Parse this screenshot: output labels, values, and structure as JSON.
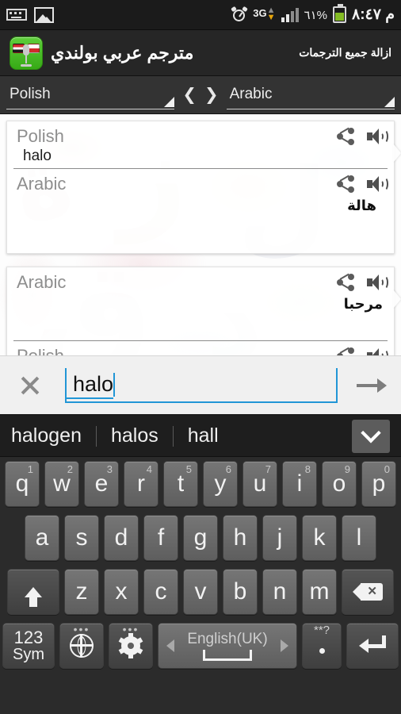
{
  "statusbar": {
    "icons": [
      "keyboard-icon",
      "image-icon",
      "alarm-icon",
      "signal-icon",
      "battery-icon"
    ],
    "network_label": "3G",
    "battery_percent": "٦١%",
    "clock": "م ٨:٤٧"
  },
  "actionbar": {
    "app_icon": "app-logo-icon",
    "title": "مترجم عربي بولندي",
    "clear_all_label": "ازالة جميع الترجمات"
  },
  "langrow": {
    "source": "Polish",
    "target": "Arabic",
    "swap_prev": "❮",
    "swap_next": "❯"
  },
  "cards": [
    {
      "source_label": "Polish",
      "source_text": "halo",
      "target_label": "Arabic",
      "target_text": "هالة"
    },
    {
      "source_label": "Arabic",
      "source_text": "مرحبا",
      "target_label": "Polish",
      "target_text": ""
    }
  ],
  "input": {
    "clear_icon": "close-icon",
    "value": "halo",
    "placeholder": "",
    "submit_icon": "arrow-right-icon"
  },
  "keyboard": {
    "suggestions": [
      "halogen",
      "halos",
      "hall"
    ],
    "expand_icon": "chevron-down-icon",
    "row1": [
      {
        "ch": "q",
        "num": "1"
      },
      {
        "ch": "w",
        "num": "2"
      },
      {
        "ch": "e",
        "num": "3"
      },
      {
        "ch": "r",
        "num": "4"
      },
      {
        "ch": "t",
        "num": "5"
      },
      {
        "ch": "y",
        "num": "6"
      },
      {
        "ch": "u",
        "num": "7"
      },
      {
        "ch": "i",
        "num": "8"
      },
      {
        "ch": "o",
        "num": "9"
      },
      {
        "ch": "p",
        "num": "0"
      }
    ],
    "row2": [
      {
        "ch": "a"
      },
      {
        "ch": "s"
      },
      {
        "ch": "d"
      },
      {
        "ch": "f"
      },
      {
        "ch": "g"
      },
      {
        "ch": "h"
      },
      {
        "ch": "j"
      },
      {
        "ch": "k"
      },
      {
        "ch": "l"
      }
    ],
    "row3": [
      {
        "ch": "z"
      },
      {
        "ch": "x"
      },
      {
        "ch": "c"
      },
      {
        "ch": "v"
      },
      {
        "ch": "b"
      },
      {
        "ch": "n"
      },
      {
        "ch": "m"
      }
    ],
    "shift_icon": "shift-up-arrow-icon",
    "backspace_icon": "backspace-icon",
    "sym_line1": "123",
    "sym_line2": "Sym",
    "globe_icon": "globe-icon",
    "settings_icon": "gear-icon",
    "space_label": "English(UK)",
    "period_top": "**?",
    "period_label": ".",
    "enter_icon": "enter-icon"
  },
  "colors": {
    "accent_blue": "#2196d6",
    "app_green": "#37aa16",
    "battery_green": "#84bb24",
    "data_orange": "#e8a60b"
  }
}
